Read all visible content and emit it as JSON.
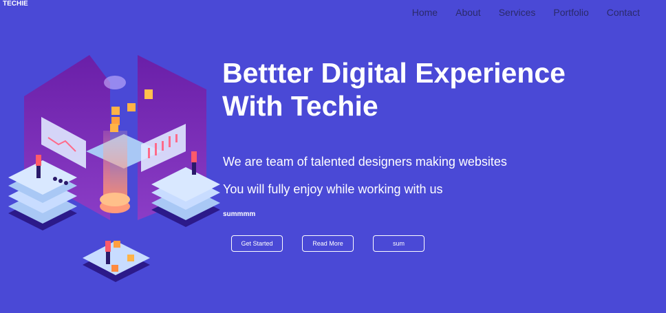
{
  "brand": {
    "logo": "TECHIE"
  },
  "nav": {
    "items": [
      "Home",
      "About",
      "Services",
      "Portfolio",
      "Contact"
    ]
  },
  "hero": {
    "title_line1": "Bettter Digital Experience",
    "title_line2": "With Techie",
    "subtitle1": "We are team of talented designers making websites",
    "subtitle2": "You will fully enjoy while working with us",
    "small_text": "summmm",
    "buttons": {
      "get_started": "Get Started",
      "read_more": "Read More",
      "sum": "sum"
    }
  },
  "colors": {
    "background": "#4a49d6",
    "nav_text": "#2a2a6a",
    "text": "#ffffff"
  },
  "illustration": {
    "icon": "isometric-data-center-illustration"
  }
}
